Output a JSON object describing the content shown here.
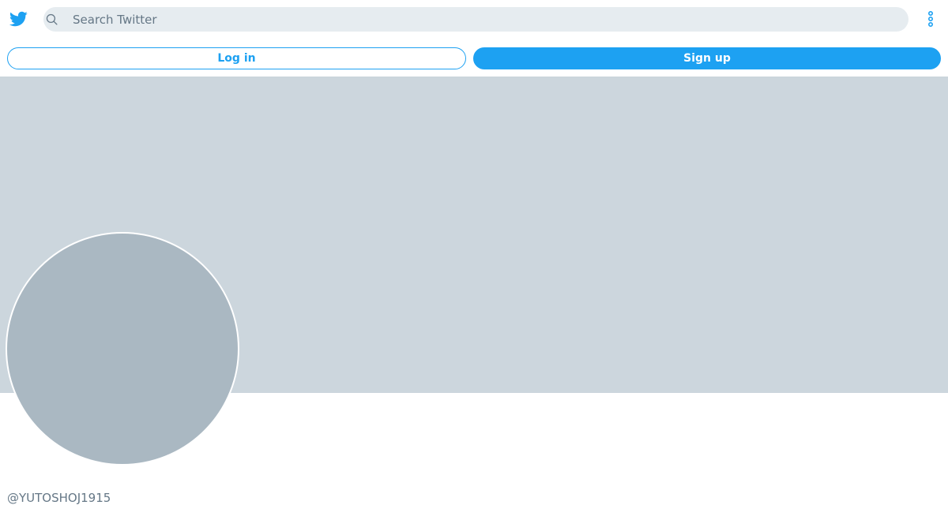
{
  "header": {
    "logo_icon": "twitter-bird-icon",
    "search": {
      "icon": "search-icon",
      "placeholder": "Search Twitter",
      "value": ""
    },
    "more_icon": "more-vertical-icon"
  },
  "auth": {
    "login_label": "Log in",
    "signup_label": "Sign up"
  },
  "profile": {
    "handle": "@YUTOSHOJ1915"
  },
  "colors": {
    "brand": "#1da1f2",
    "banner": "#ccd6dd",
    "avatar": "#aab8c2",
    "search_bg": "#e6ecf0",
    "muted_text": "#657786"
  }
}
